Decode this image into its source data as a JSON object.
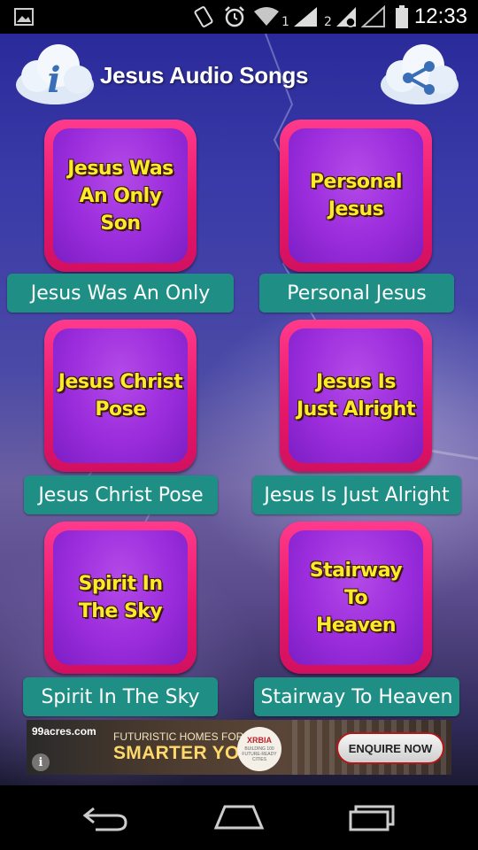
{
  "status_bar": {
    "time": "12:33",
    "sim1_label": "1",
    "sim2_label": "2",
    "icons": [
      "image-icon",
      "vibrate-icon",
      "alarm-icon",
      "wifi-icon",
      "signal-icon",
      "signal-icon",
      "battery-icon"
    ]
  },
  "header": {
    "title": "Jesus Audio Songs",
    "info_glyph": "i",
    "icons": [
      "info-cloud-icon",
      "share-cloud-icon"
    ]
  },
  "songs": [
    {
      "tile_text": "Jesus Was\nAn Only\nSon",
      "label": "Jesus Was An Only"
    },
    {
      "tile_text": "Personal\nJesus",
      "label": "Personal Jesus"
    },
    {
      "tile_text": "Jesus Christ\nPose",
      "label": "Jesus Christ Pose"
    },
    {
      "tile_text": "Jesus Is\nJust Alright",
      "label": "Jesus Is Just Alright"
    },
    {
      "tile_text": "Spirit In\nThe Sky",
      "label": "Spirit In The Sky"
    },
    {
      "tile_text": "Stairway\nTo\nHeaven",
      "label": "Stairway To Heaven"
    }
  ],
  "ad": {
    "site": "99acres.com",
    "line1": "FUTURISTIC HOMES FOR A",
    "line2": "SMARTER YOU",
    "brand": "XRBIA",
    "brand_sub": "BUILDING 100 FUTURE-READY CITIES",
    "cta": "ENQUIRE NOW",
    "info_glyph": "i"
  },
  "nav": {
    "icons": [
      "back-icon",
      "home-icon",
      "recents-icon"
    ]
  },
  "colors": {
    "tile_border": "#e8186a",
    "tile_inner": "#9a2cdc",
    "tile_text": "#ffea2a",
    "label_bg": "#1f8f86"
  }
}
